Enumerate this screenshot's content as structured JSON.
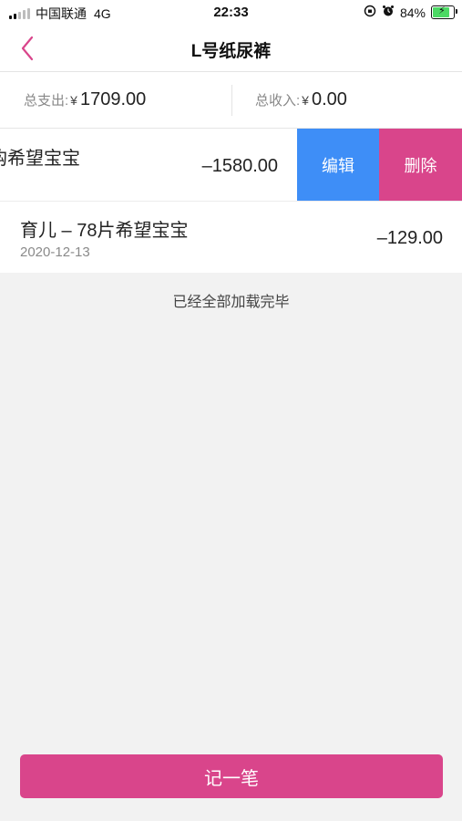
{
  "status_bar": {
    "carrier": "中国联通",
    "network": "4G",
    "time": "22:33",
    "battery": "84%",
    "battery_level": 0.84
  },
  "nav": {
    "title": "L号纸尿裤"
  },
  "summary": {
    "expense_label": "总支出:",
    "expense_currency": "¥",
    "expense_amount": "1709.00",
    "income_label": "总收入:",
    "income_currency": "¥",
    "income_amount": "0.00"
  },
  "records": [
    {
      "title": "购希望宝宝",
      "amount": "–1580.00",
      "edit_label": "编辑",
      "delete_label": "删除"
    },
    {
      "title": "育儿 – 78片希望宝宝",
      "date": "2020-12-13",
      "amount": "–129.00"
    }
  ],
  "list_footer": "已经全部加载完毕",
  "bottom_button": "记一笔",
  "colors": {
    "accent": "#d9458b",
    "edit": "#3e8ef7",
    "battery_fill": "#4cd964"
  }
}
